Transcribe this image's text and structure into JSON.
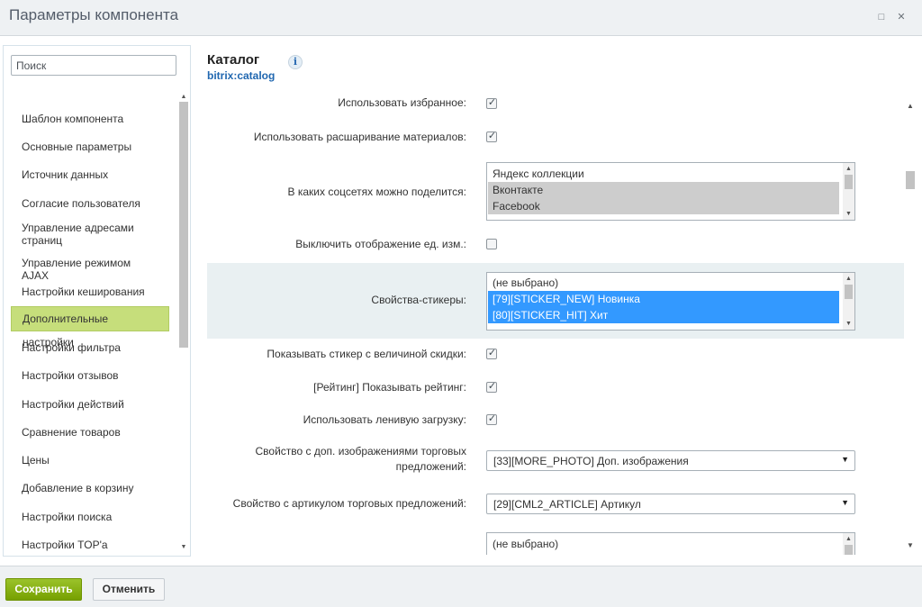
{
  "window": {
    "title": "Параметры компонента",
    "maximize_icon": "□",
    "close_icon": "✕"
  },
  "sidebar": {
    "search_placeholder": "Поиск",
    "items": [
      {
        "label": "Шаблон компонента"
      },
      {
        "label": "Основные параметры"
      },
      {
        "label": "Источник данных"
      },
      {
        "label": "Согласие пользователя"
      },
      {
        "label": "Управление адресами страниц"
      },
      {
        "label": "Управление режимом AJAX"
      },
      {
        "label": "Настройки кеширования"
      },
      {
        "label": "Дополнительные настройки",
        "active": true
      },
      {
        "label": "Настройки фильтра"
      },
      {
        "label": "Настройки отзывов"
      },
      {
        "label": "Настройки действий"
      },
      {
        "label": "Сравнение товаров"
      },
      {
        "label": "Цены"
      },
      {
        "label": "Добавление в корзину"
      },
      {
        "label": "Настройки поиска"
      },
      {
        "label": "Настройки TOP'a"
      }
    ]
  },
  "header": {
    "title": "Каталог",
    "code": "bitrix:catalog",
    "info_icon": "i"
  },
  "settings": {
    "use_favorites": {
      "label": "Использовать избранное:",
      "checked": true
    },
    "use_share": {
      "label": "Использовать расшаривание материалов:",
      "checked": true
    },
    "social_networks": {
      "label": "В каких соцсетях можно поделится:",
      "options": [
        "Яндекс коллекции",
        "Вконтакте",
        "Facebook"
      ]
    },
    "hide_measure": {
      "label": "Выключить отображение ед. изм.:",
      "checked": false
    },
    "sticker_props": {
      "label": "Свойства-стикеры:",
      "options": [
        "(не выбрано)",
        "[79][STICKER_NEW] Новинка",
        "[80][STICKER_HIT] Хит"
      ]
    },
    "show_discount_sticker": {
      "label": "Показывать стикер с величиной скидки:",
      "checked": true
    },
    "show_rating": {
      "label": "[Рейтинг] Показывать рейтинг:",
      "checked": true
    },
    "lazy_load": {
      "label": "Использовать ленивую загрузку:",
      "checked": true
    },
    "offer_more_photo": {
      "label": "Свойство с доп. изображениями торговых предложений:",
      "value": "[33][MORE_PHOTO] Доп. изображения"
    },
    "offer_article": {
      "label": "Свойство с артикулом торговых предложений:",
      "value": "[29][CML2_ARTICLE] Артикул"
    },
    "next_list": {
      "options": [
        "(не выбрано)"
      ]
    }
  },
  "footer": {
    "save_label": "Сохранить",
    "cancel_label": "Отменить"
  },
  "colors": {
    "active_nav": "#c6de7b",
    "save_button": "#86ad00",
    "selection_blue": "#3399ff",
    "link_blue": "#2067b0"
  }
}
